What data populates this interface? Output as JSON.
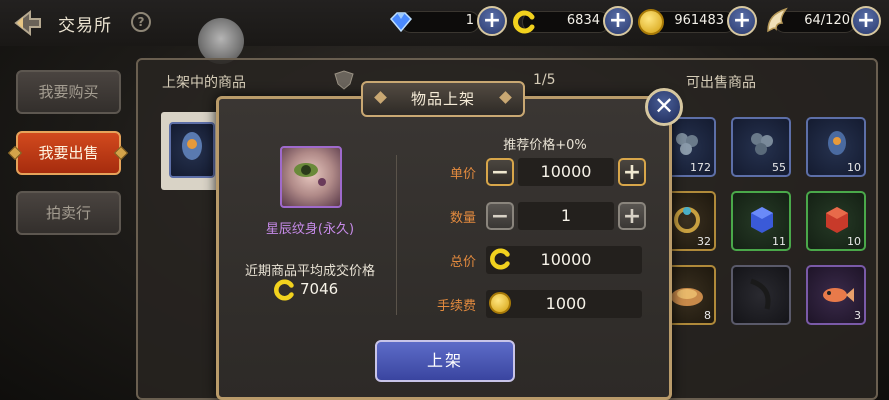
{
  "header": {
    "title": "交易所",
    "help_icon": "?",
    "resources": [
      {
        "icon": "blue-gem-icon",
        "value": "1"
      },
      {
        "icon": "yellow-c-coin-icon",
        "value": "6834"
      },
      {
        "icon": "gold-coin-icon",
        "value": "961483"
      },
      {
        "icon": "wing-energy-icon",
        "value": "64/120"
      }
    ]
  },
  "sidebar": {
    "items": [
      {
        "label": "我要购买",
        "active": false
      },
      {
        "label": "我要出售",
        "active": true
      },
      {
        "label": "拍卖行",
        "active": false
      }
    ]
  },
  "market": {
    "listed_header": "上架中的商品",
    "partial_header": "1/5",
    "sellable_header": "可出售商品",
    "inventory": [
      {
        "count": "172"
      },
      {
        "count": "55"
      },
      {
        "count": "10"
      },
      {
        "count": "32"
      },
      {
        "count": "11"
      },
      {
        "count": "10"
      },
      {
        "count": "8"
      },
      {
        "count": ""
      },
      {
        "count": "3"
      }
    ]
  },
  "dialog": {
    "title": "物品上架",
    "item_name": "星辰纹身(永久)",
    "avg_price_label": "近期商品平均成交价格",
    "avg_price_value": "7046",
    "recommended": "推荐价格+0%",
    "unit_price_label": "单价",
    "unit_price_value": "10000",
    "quantity_label": "数量",
    "quantity_value": "1",
    "total_label": "总价",
    "total_value": "10000",
    "fee_label": "手续费",
    "fee_value": "1000",
    "submit_label": "上架",
    "close_symbol": "✕"
  },
  "colors": {
    "accent_orange": "#e28a3e",
    "active_tab": "#c23a14",
    "item_name_purple": "#c68ae8",
    "button_blue": "#4a58b8"
  }
}
